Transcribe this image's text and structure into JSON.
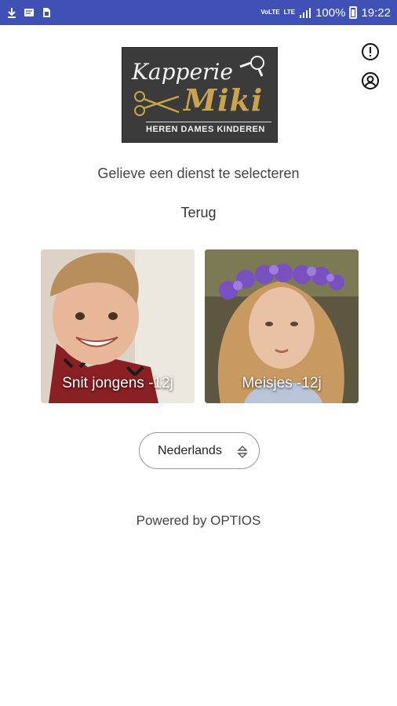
{
  "status_bar": {
    "network_1": "VoLTE",
    "network_2": "LTE",
    "battery": "100%",
    "time": "19:22"
  },
  "logo": {
    "line1": "Kapperie",
    "line2": "Miki",
    "line3": "HEREN  DAMES  KINDEREN"
  },
  "icons": {
    "info": "info-icon",
    "account": "account-icon"
  },
  "prompt": "Gelieve een dienst te selecteren",
  "back_label": "Terug",
  "services": [
    {
      "label": "Snit jongens -12j"
    },
    {
      "label": "Meisjes -12j"
    }
  ],
  "language": {
    "selected": "Nederlands"
  },
  "footer": "Powered by OPTIOS",
  "colors": {
    "status_bar": "#3f51b5",
    "logo_background": "#3b3b3b",
    "logo_gold": "#c9a44c"
  }
}
